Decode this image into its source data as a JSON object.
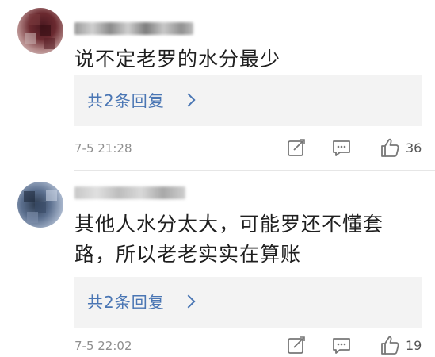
{
  "comments": [
    {
      "text": "说不定老罗的水分最少",
      "replies_label": "共2条回复",
      "time": "7-5 21:28",
      "likes": "36"
    },
    {
      "text": "其他人水分太大，可能罗还不懂套路，所以老老实实在算账",
      "replies_label": "共2条回复",
      "time": "7-5 22:02",
      "likes": "19"
    }
  ],
  "icons": {
    "edit": "edit-icon",
    "reply": "comment-icon",
    "like": "thumbs-up-icon",
    "chevron": "chevron-right-icon"
  },
  "colors": {
    "link": "#4a76b4",
    "reply_box": "#f3f3f3",
    "meta": "#8f8f8f"
  }
}
